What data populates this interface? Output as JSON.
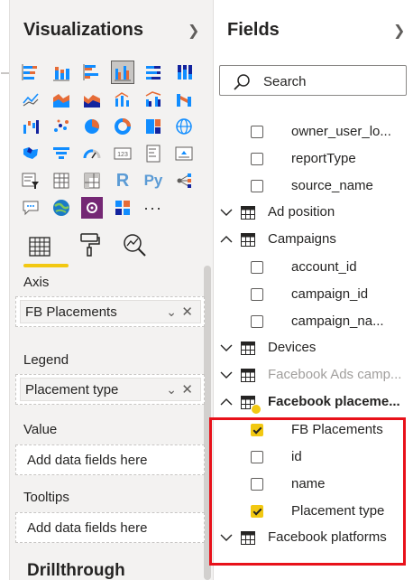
{
  "visualizations": {
    "title": "Visualizations",
    "more_label": "...",
    "r_label": "R",
    "py_label": "Py",
    "tabs": [
      "fields-tab",
      "format-tab",
      "analytics-tab"
    ],
    "wells": {
      "axis": {
        "label": "Axis",
        "field": "FB Placements"
      },
      "legend": {
        "label": "Legend",
        "field": "Placement type"
      },
      "value": {
        "label": "Value",
        "placeholder": "Add data fields here"
      },
      "tooltips": {
        "label": "Tooltips",
        "placeholder": "Add data fields here"
      }
    },
    "drillthrough_label": "Drillthrough"
  },
  "fields": {
    "title": "Fields",
    "search_placeholder": "Search",
    "items": [
      {
        "kind": "field",
        "name": "owner_user_lo...",
        "checked": false
      },
      {
        "kind": "field",
        "name": "reportType",
        "checked": false
      },
      {
        "kind": "field",
        "name": "source_name",
        "checked": false
      },
      {
        "kind": "table",
        "name": "Ad position",
        "expanded": false
      },
      {
        "kind": "table",
        "name": "Campaigns",
        "expanded": true
      },
      {
        "kind": "field",
        "name": "account_id",
        "checked": false
      },
      {
        "kind": "field",
        "name": "campaign_id",
        "checked": false
      },
      {
        "kind": "field",
        "name": "campaign_na...",
        "checked": false
      },
      {
        "kind": "table",
        "name": "Devices",
        "expanded": false
      },
      {
        "kind": "table",
        "name": "Facebook Ads camp...",
        "expanded": false,
        "muted": true
      },
      {
        "kind": "table",
        "name": "Facebook placeme...",
        "expanded": true,
        "active": true
      },
      {
        "kind": "field",
        "name": "FB Placements",
        "checked": true
      },
      {
        "kind": "field",
        "name": "id",
        "checked": false
      },
      {
        "kind": "field",
        "name": "name",
        "checked": false
      },
      {
        "kind": "field",
        "name": "Placement type",
        "checked": true
      },
      {
        "kind": "table",
        "name": "Facebook platforms",
        "expanded": false
      }
    ]
  },
  "colors": {
    "accent_yellow": "#f2c811",
    "highlight_red": "#e8111a",
    "viz_blue": "#118dff",
    "viz_orange": "#e66c37",
    "viz_navy": "#12239e",
    "viz_purple": "#6b007b"
  }
}
